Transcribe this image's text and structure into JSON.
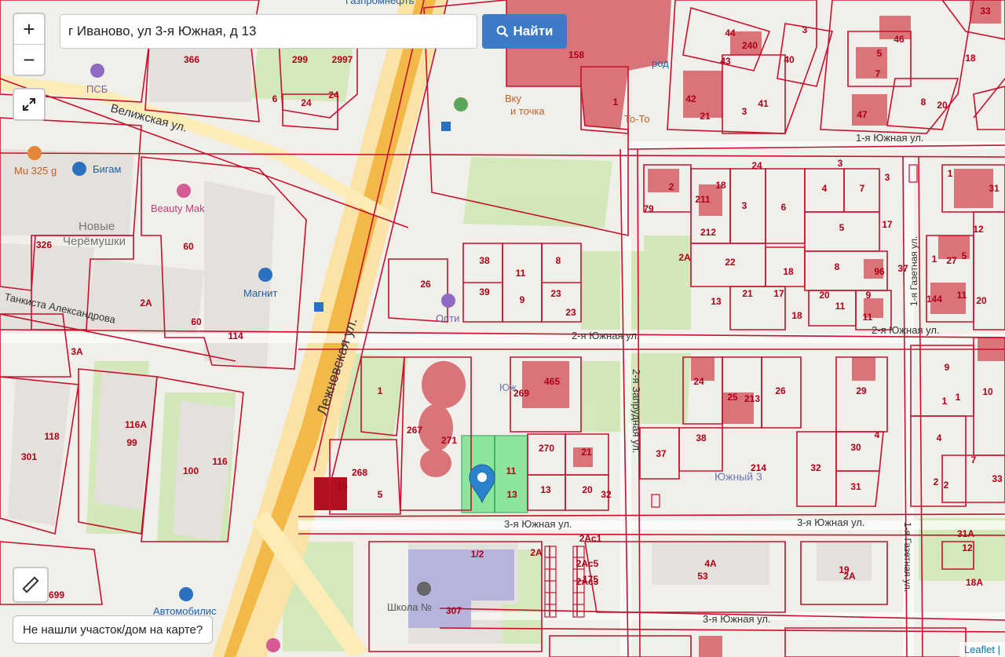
{
  "search": {
    "value": "г Иваново, ул 3-я Южная, д 13",
    "button_label": "Найти"
  },
  "zoom": {
    "in": "+",
    "out": "−"
  },
  "not_found_label": "Не нашли участок/дом на карте?",
  "attribution": "Leaflet |",
  "colors": {
    "parcel_line": "#c8102e",
    "building": "#d9747a",
    "road_main": "#f2b949",
    "selected": "#62e07e",
    "button": "#3d7bc6"
  },
  "icons": [
    "search-icon",
    "fullscreen-icon",
    "ruler-icon",
    "map-marker-icon"
  ],
  "streets": {
    "lezhnevskaya": "Лежневская ул.",
    "velizhskaya": "Велижская ул.",
    "yuzhnaya1": "1-я Южная ул.",
    "yuzhnaya2a": "2-я Южная ул.",
    "yuzhnaya2b": "2-я Южная ул.",
    "yuzhnaya3a": "3-я Южная ул.",
    "yuzhnaya3b": "3-я Южная ул.",
    "yuzhnaya3c": "3-я Южная ул.",
    "zaprudnaya": "2-я Запрудная ул.",
    "gazetnaya1": "1-я Газетная ул.",
    "gazetnaya2": "1-я Газетная ул.",
    "tankista": "Танкиста Александрова"
  },
  "pois": {
    "psb": "ПСБ",
    "bigam": "Бигам",
    "mu": "Mu 325 g",
    "beauty": "Beauty Mak",
    "magnit": "Магнит",
    "cheremushki1": "Новые",
    "cheremushki2": "Черёмушки",
    "optika": "Опти",
    "school": "Школа №",
    "avto": "Автомобилис",
    "gazprom": "Газпромнефть",
    "vkus1": "Вку",
    "vkus2": "и точка",
    "toto": "То-То",
    "gorod": "род",
    "yuzh1": "Юж",
    "yuzh2": "Южный 3"
  },
  "parcel_numbers": [
    "366",
    "299",
    "2997",
    "24",
    "24",
    "6",
    "158",
    "1",
    "44",
    "240",
    "3",
    "43",
    "40",
    "42",
    "41",
    "21",
    "46",
    "7",
    "5",
    "47",
    "8",
    "20",
    "18",
    "33",
    "2",
    "211",
    "212",
    "18",
    "3",
    "6",
    "4",
    "7",
    "5",
    "22",
    "18",
    "8",
    "96",
    "1",
    "27",
    "12",
    "13",
    "31",
    "38",
    "11",
    "8",
    "39",
    "9",
    "23",
    "23",
    "26",
    "21",
    "17",
    "18",
    "20",
    "9",
    "11",
    "144",
    "11",
    "326",
    "60",
    "2А",
    "60",
    "114",
    "465",
    "269",
    "1",
    "267",
    "271",
    "270",
    "21",
    "20",
    "13",
    "11",
    "13",
    "24",
    "25",
    "213",
    "26",
    "29",
    "37",
    "38",
    "214",
    "32",
    "30",
    "31",
    "9",
    "1",
    "10",
    "4",
    "7",
    "2",
    "33",
    "3А",
    "118",
    "116А",
    "99",
    "100",
    "116",
    "301",
    "268",
    "5",
    "15",
    "1/2",
    "307",
    "2А",
    "175",
    "4А",
    "53",
    "19",
    "2А",
    "12",
    "31А",
    "18А",
    "699",
    "2Ас1",
    "2Ас5",
    "2Ас3",
    "2",
    "1",
    "20",
    "24",
    "3",
    "3",
    "79",
    "2А",
    "11",
    "37",
    "1",
    "3",
    "17",
    "32",
    "4",
    "5"
  ]
}
